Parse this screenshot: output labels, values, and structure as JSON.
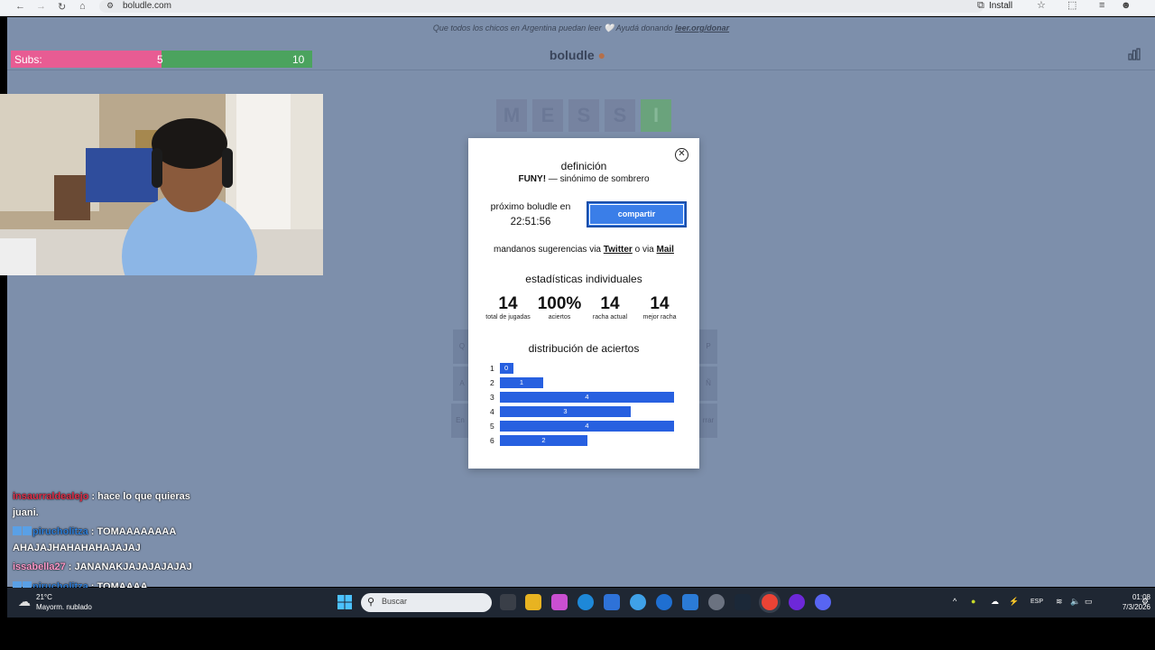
{
  "browser": {
    "url": "boludle.com",
    "install_label": "Install"
  },
  "banner": {
    "text": "Que todos los chicos en Argentina puedan leer",
    "cta_text": "Ayudá donando",
    "cta_link": "leer.org/donar"
  },
  "header": {
    "brand": "boludle"
  },
  "subgoal": {
    "label": "Subs:",
    "current": "5",
    "goal": "10",
    "fill_fraction": 0.5
  },
  "board": {
    "letters": [
      "M",
      "E",
      "S",
      "S",
      "I"
    ]
  },
  "keyboard_fragments": [
    "Q",
    "P",
    "A",
    "Ñ",
    "En",
    "rrar"
  ],
  "modal": {
    "definition_title": "definición",
    "definition_word": "FUNY!",
    "definition_text": " — sinónimo de sombrero",
    "next_label": "próximo boludle en",
    "next_time": "22:51:56",
    "share_label": "compartir",
    "suggest_prefix": "mandanos sugerencias via ",
    "suggest_twitter": "Twitter",
    "suggest_mid": " o via ",
    "suggest_mail": "Mail",
    "stats_title": "estadísticas individuales",
    "stats": [
      {
        "value": "14",
        "label": "total de jugadas"
      },
      {
        "value": "100%",
        "label": "aciertos"
      },
      {
        "value": "14",
        "label": "racha actual"
      },
      {
        "value": "14",
        "label": "mejor racha"
      }
    ],
    "distribution_title": "distribución de aciertos",
    "distribution": [
      {
        "guess": "1",
        "count": 0
      },
      {
        "guess": "2",
        "count": 1
      },
      {
        "guess": "3",
        "count": 4
      },
      {
        "guess": "4",
        "count": 3
      },
      {
        "guess": "5",
        "count": 4
      },
      {
        "guess": "6",
        "count": 2
      }
    ]
  },
  "chat": [
    {
      "user": "insaurraldealejo",
      "text": " : hace lo que quieras",
      "cont": "juani.",
      "color": "#e0304a",
      "badges": 0
    },
    {
      "user": "pirucholitza",
      "text": " : TOMAAAAAAAA",
      "cont": "AHAJAJHAHAHAHAJAJAJ",
      "color": "#2f7fd8",
      "badges": 2
    },
    {
      "user": "issabella27",
      "text": " : JANANAKJAJAJAJAJAJ",
      "cont": "",
      "color": "#ff9acb",
      "badges": 0
    },
    {
      "user": "pirucholitza",
      "text": " : TOMAAAA",
      "cont": "",
      "color": "#2f7fd8",
      "badges": 2
    }
  ],
  "taskbar": {
    "weather_temp": "21°C",
    "weather_desc": "Mayorm. nublado",
    "search_placeholder": "Buscar",
    "lang": "ESP",
    "time": "01:08",
    "date": "7/3/2026"
  }
}
